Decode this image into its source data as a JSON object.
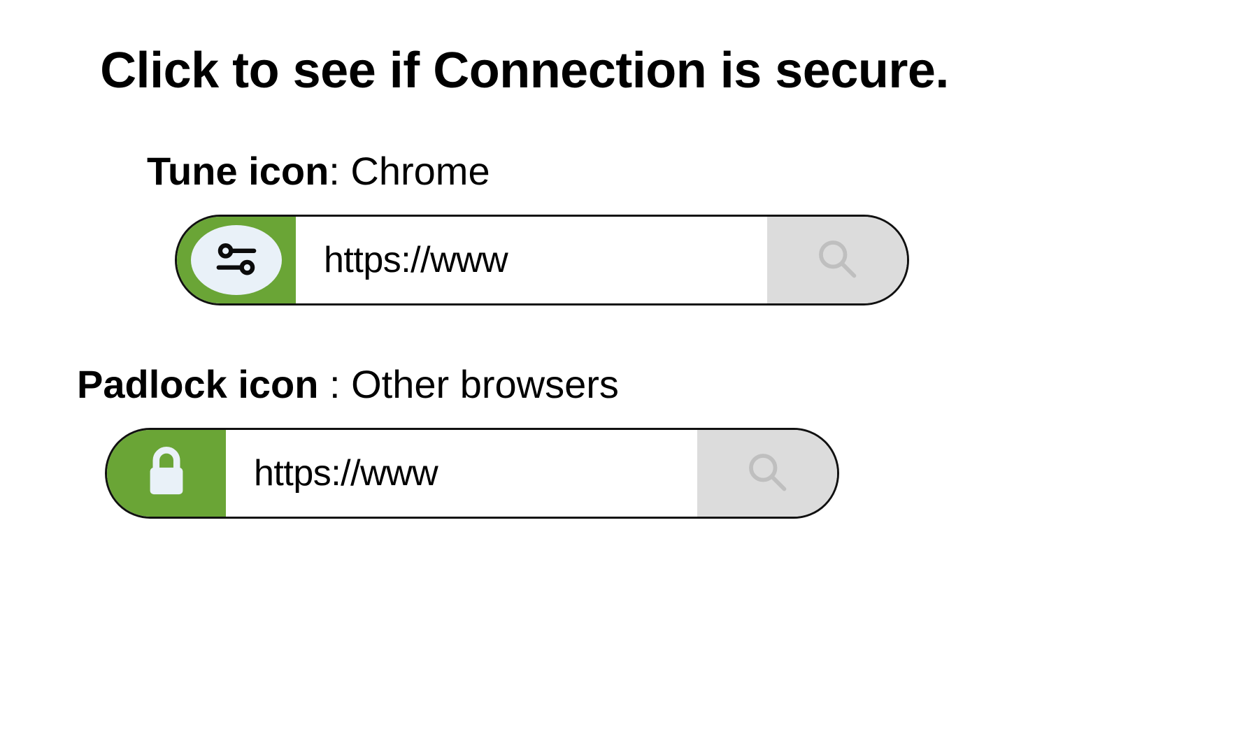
{
  "title": "Click to see if Connection is secure.",
  "colors": {
    "badge_green": "#6aa536",
    "icon_light": "#e9f1f8",
    "search_bg": "#dcdcdc",
    "search_stroke": "#bfbfbf"
  },
  "sections": [
    {
      "label_bold": "Tune icon",
      "label_sep": ": ",
      "label_rest": "Chrome",
      "icon": "tune-icon",
      "url": "https://www"
    },
    {
      "label_bold": "Padlock icon ",
      "label_sep": ": ",
      "label_rest": "Other browsers",
      "icon": "padlock-icon",
      "url": "https://www"
    }
  ]
}
